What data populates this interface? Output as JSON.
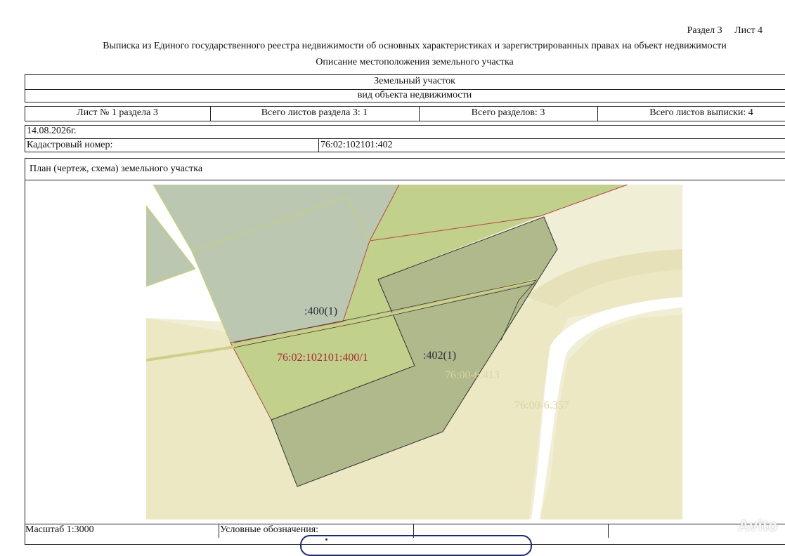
{
  "header": {
    "section": "Раздел 3",
    "sheet": "Лист 4",
    "title": "Выписка из Единого государственного реестра недвижимости об основных характеристиках и зарегистрированных правах на объект недвижимости",
    "subtitle": "Описание местоположения земельного участка"
  },
  "object": {
    "kind": "Земельный участок",
    "kind_caption": "вид объекта недвижимости"
  },
  "sheet_info": {
    "sheet_no": "Лист № 1 раздела 3",
    "total_sheets_section": "Всего листов раздела 3: 1",
    "total_sections": "Всего разделов: 3",
    "total_sheets_extract": "Всего листов выписки: 4"
  },
  "date": "14.08.2026г.",
  "cadastral": {
    "label": "Кадастровый номер:",
    "value": "76:02:102101:402"
  },
  "plan": {
    "title": "План (чертеж, схема) земельного участка",
    "labels": {
      "parcel_400": ":400(1)",
      "parcel_400_full": "76:02:102101:400/1",
      "parcel_402": ":402(1)",
      "zone_413": "76:00-6.413",
      "zone_357": "76:00-6.357"
    },
    "colors": {
      "background_beige": "#ece8c4",
      "pale_beige": "#f1eed6",
      "gray_green": "#bcc7b2",
      "green": "#c1d08a",
      "olive": "#afb98b",
      "red_label": "#a8283c",
      "zone_label": "#d9d4a0"
    }
  },
  "footer": {
    "scale": "Масштаб 1:3000",
    "legend": "Условные обозначения:"
  },
  "watermark": "Avito"
}
